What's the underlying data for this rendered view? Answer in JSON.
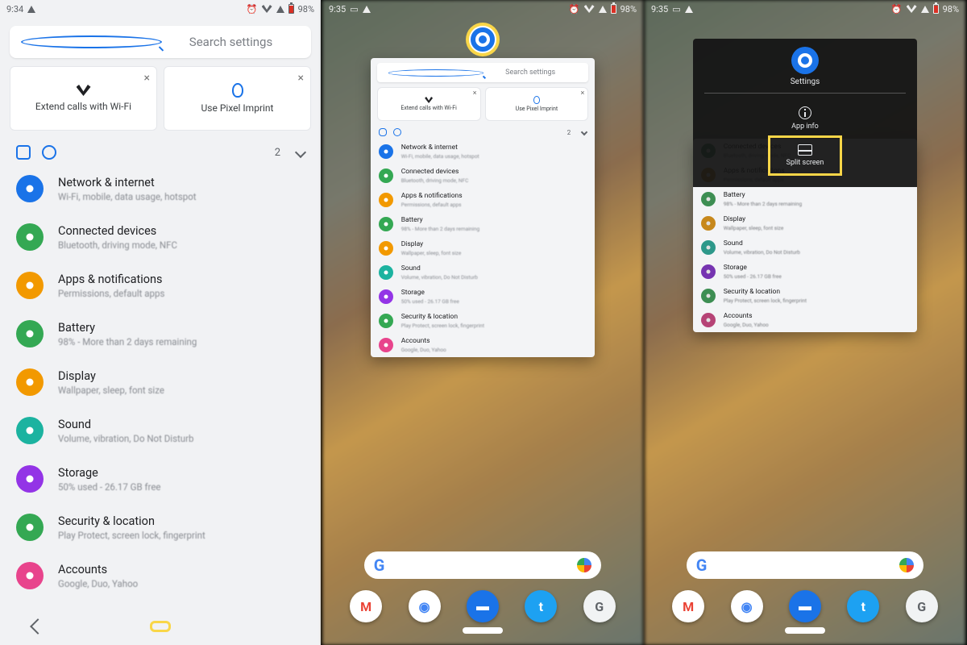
{
  "status": {
    "time1": "9:34",
    "time23": "9:35",
    "battery": "98%"
  },
  "search_placeholder": "Search settings",
  "suggestions": [
    {
      "label": "Extend calls with Wi-Fi",
      "icon": "wifi"
    },
    {
      "label": "Use Pixel Imprint",
      "icon": "fingerprint"
    }
  ],
  "chip_count": "2",
  "settings": [
    {
      "title": "Network & internet",
      "sub": "Wi-Fi, mobile, data usage, hotspot",
      "color": "#1a73e8"
    },
    {
      "title": "Connected devices",
      "sub": "Bluetooth, driving mode, NFC",
      "color": "#34a853"
    },
    {
      "title": "Apps & notifications",
      "sub": "Permissions, default apps",
      "color": "#f29900"
    },
    {
      "title": "Battery",
      "sub": "98% - More than 2 days remaining",
      "color": "#34a853"
    },
    {
      "title": "Display",
      "sub": "Wallpaper, sleep, font size",
      "color": "#f29900"
    },
    {
      "title": "Sound",
      "sub": "Volume, vibration, Do Not Disturb",
      "color": "#1cb3a0"
    },
    {
      "title": "Storage",
      "sub": "50% used - 26.17 GB free",
      "color": "#9334e6"
    },
    {
      "title": "Security & location",
      "sub": "Play Protect, screen lock, fingerprint",
      "color": "#34a853"
    },
    {
      "title": "Accounts",
      "sub": "Google, Duo, Yahoo",
      "color": "#e8448c"
    }
  ],
  "recents": {
    "app_name": "Settings",
    "menu": {
      "app_info": "App info",
      "split_screen": "Split screen"
    }
  },
  "dock": [
    "gmail",
    "chrome",
    "messages",
    "twitter",
    "google"
  ]
}
